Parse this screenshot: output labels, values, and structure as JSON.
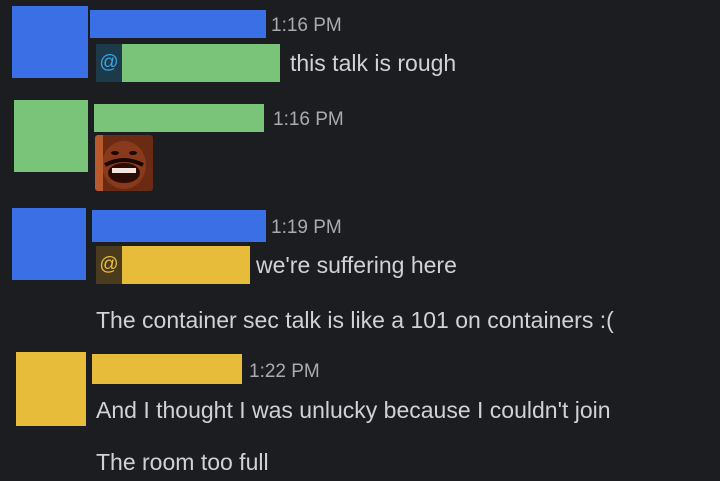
{
  "colors": {
    "background": "#1b1d21",
    "blue_user": "#3b6fe6",
    "green_user": "#7ac47a",
    "yellow_user": "#e6bc3a",
    "timestamp": "#ababad",
    "text": "#d1d2d3",
    "mention_blue_bg": "#1d3a4a",
    "mention_yellow_bg": "#4a3b1e"
  },
  "messages": [
    {
      "time": "1:16 PM",
      "mention_symbol": "@",
      "text": "this talk is rough"
    },
    {
      "time": "1:16 PM",
      "emoji_icon": "laughing-face-emoji"
    },
    {
      "time": "1:19 PM",
      "mention_symbol": "@",
      "text": "we're suffering here",
      "text2": "The container sec talk is like a 101 on containers :("
    },
    {
      "time": "1:22 PM",
      "text": "And I thought I was unlucky because I couldn't join",
      "text2": "The room too full"
    }
  ]
}
